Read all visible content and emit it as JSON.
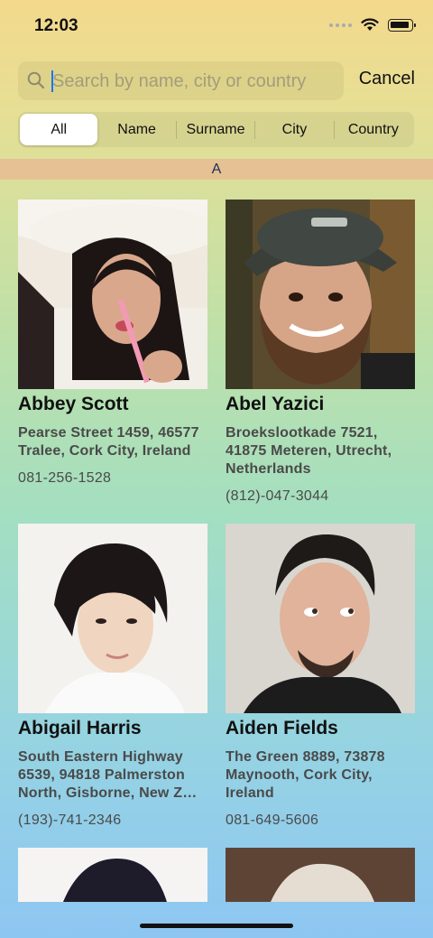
{
  "status": {
    "time": "12:03"
  },
  "search": {
    "placeholder": "Search by name, city or country",
    "value": "",
    "cancel_label": "Cancel"
  },
  "filters": [
    "All",
    "Name",
    "Surname",
    "City",
    "Country"
  ],
  "filter_selected": "All",
  "section": {
    "letter": "A"
  },
  "contacts": [
    {
      "name": "Abbey Scott",
      "address": "Pearse Street 1459, 46577 Tralee, Cork City, Ireland",
      "phone": "081-256-1528"
    },
    {
      "name": "Abel Yazici",
      "address": "Broekslootkade 7521, 41875 Meteren, Utrecht, Netherlands",
      "phone": "(812)-047-3044"
    },
    {
      "name": "Abigail Harris",
      "address": "South Eastern Highway 6539, 94818 Palmerston North, Gisborne, New Z…",
      "phone": "(193)-741-2346"
    },
    {
      "name": "Aiden Fields",
      "address": "The Green 8889, 73878 Maynooth, Cork City, Ireland",
      "phone": "081-649-5606"
    }
  ]
}
